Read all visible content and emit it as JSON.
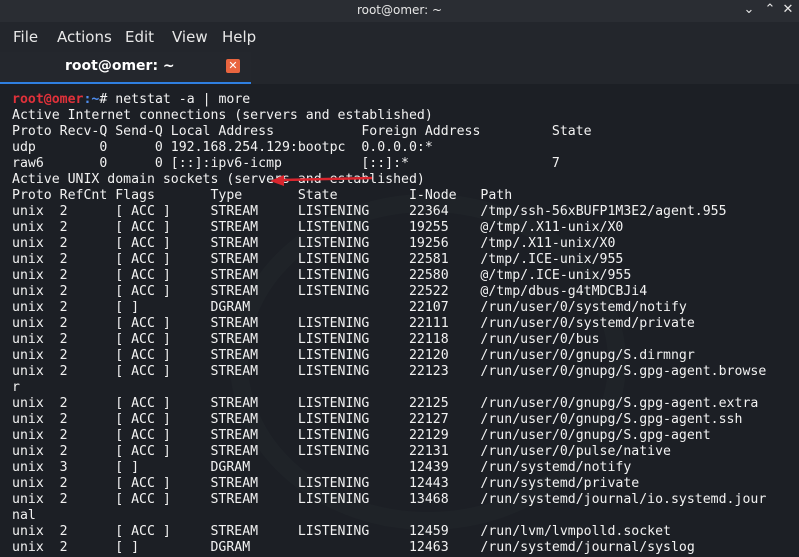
{
  "window": {
    "title": "root@omer: ~"
  },
  "menu": {
    "file": "File",
    "actions": "Actions",
    "edit": "Edit",
    "view": "View",
    "help": "Help"
  },
  "tab": {
    "label": "root@omer: ~"
  },
  "prompt": {
    "user": "root@omer",
    "path": ":~",
    "symbol": "# ",
    "command": "netstat -a | more"
  },
  "output": [
    "Active Internet connections (servers and established)",
    "Proto Recv-Q Send-Q Local Address           Foreign Address         State",
    "udp        0      0 192.168.254.129:bootpc  0.0.0.0:*",
    "raw6       0      0 [::]:ipv6-icmp          [::]:*                  7",
    "Active UNIX domain sockets (servers and established)",
    "Proto RefCnt Flags       Type       State         I-Node   Path",
    "unix  2      [ ACC ]     STREAM     LISTENING     22364    /tmp/ssh-56xBUFP1M3E2/agent.955",
    "unix  2      [ ACC ]     STREAM     LISTENING     19255    @/tmp/.X11-unix/X0",
    "unix  2      [ ACC ]     STREAM     LISTENING     19256    /tmp/.X11-unix/X0",
    "unix  2      [ ACC ]     STREAM     LISTENING     22581    /tmp/.ICE-unix/955",
    "unix  2      [ ACC ]     STREAM     LISTENING     22580    @/tmp/.ICE-unix/955",
    "unix  2      [ ACC ]     STREAM     LISTENING     22522    @/tmp/dbus-g4tMDCBJi4",
    "unix  2      [ ]         DGRAM                    22107    /run/user/0/systemd/notify",
    "unix  2      [ ACC ]     STREAM     LISTENING     22111    /run/user/0/systemd/private",
    "unix  2      [ ACC ]     STREAM     LISTENING     22118    /run/user/0/bus",
    "unix  2      [ ACC ]     STREAM     LISTENING     22120    /run/user/0/gnupg/S.dirmngr",
    "unix  2      [ ACC ]     STREAM     LISTENING     22123    /run/user/0/gnupg/S.gpg-agent.browse",
    "r",
    "unix  2      [ ACC ]     STREAM     LISTENING     22125    /run/user/0/gnupg/S.gpg-agent.extra",
    "unix  2      [ ACC ]     STREAM     LISTENING     22127    /run/user/0/gnupg/S.gpg-agent.ssh",
    "unix  2      [ ACC ]     STREAM     LISTENING     22129    /run/user/0/gnupg/S.gpg-agent",
    "unix  2      [ ACC ]     STREAM     LISTENING     22131    /run/user/0/pulse/native",
    "unix  3      [ ]         DGRAM                    12439    /run/systemd/notify",
    "unix  2      [ ACC ]     STREAM     LISTENING     12443    /run/systemd/private",
    "unix  2      [ ACC ]     STREAM     LISTENING     13468    /run/systemd/journal/io.systemd.jour",
    "nal",
    "unix  2      [ ACC ]     STREAM     LISTENING     12459    /run/lvm/lvmpolld.socket",
    "unix  2      [ ]         DGRAM                    12463    /run/systemd/journal/syslog"
  ],
  "colors": {
    "prompt_user": "#e0313a",
    "prompt_path": "#4f8ef0",
    "tab_accent": "#2f7fe0",
    "arrow": "#d9262e"
  }
}
